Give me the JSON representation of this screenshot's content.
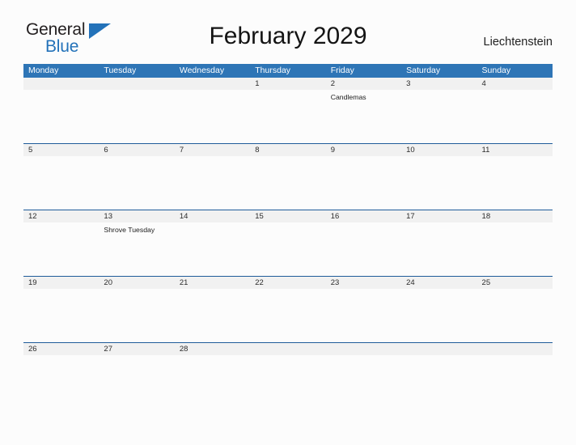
{
  "brand": {
    "name_top": "General",
    "name_bottom": "Blue",
    "triangle_color": "#2372b9"
  },
  "header": {
    "title": "February 2029",
    "country": "Liechtenstein"
  },
  "colors": {
    "header_blue": "#2e75b6",
    "separator_blue": "#1f5c99",
    "date_band_gray": "#f1f1f1",
    "page_background": "#fcfcfc"
  },
  "calendar": {
    "weekdays": [
      "Monday",
      "Tuesday",
      "Wednesday",
      "Thursday",
      "Friday",
      "Saturday",
      "Sunday"
    ],
    "weeks": [
      [
        {
          "date": "",
          "events": []
        },
        {
          "date": "",
          "events": []
        },
        {
          "date": "",
          "events": []
        },
        {
          "date": "1",
          "events": []
        },
        {
          "date": "2",
          "events": [
            "Candlemas"
          ]
        },
        {
          "date": "3",
          "events": []
        },
        {
          "date": "4",
          "events": []
        }
      ],
      [
        {
          "date": "5",
          "events": []
        },
        {
          "date": "6",
          "events": []
        },
        {
          "date": "7",
          "events": []
        },
        {
          "date": "8",
          "events": []
        },
        {
          "date": "9",
          "events": []
        },
        {
          "date": "10",
          "events": []
        },
        {
          "date": "11",
          "events": []
        }
      ],
      [
        {
          "date": "12",
          "events": []
        },
        {
          "date": "13",
          "events": [
            "Shrove Tuesday"
          ]
        },
        {
          "date": "14",
          "events": []
        },
        {
          "date": "15",
          "events": []
        },
        {
          "date": "16",
          "events": []
        },
        {
          "date": "17",
          "events": []
        },
        {
          "date": "18",
          "events": []
        }
      ],
      [
        {
          "date": "19",
          "events": []
        },
        {
          "date": "20",
          "events": []
        },
        {
          "date": "21",
          "events": []
        },
        {
          "date": "22",
          "events": []
        },
        {
          "date": "23",
          "events": []
        },
        {
          "date": "24",
          "events": []
        },
        {
          "date": "25",
          "events": []
        }
      ],
      [
        {
          "date": "26",
          "events": []
        },
        {
          "date": "27",
          "events": []
        },
        {
          "date": "28",
          "events": []
        },
        {
          "date": "",
          "events": []
        },
        {
          "date": "",
          "events": []
        },
        {
          "date": "",
          "events": []
        },
        {
          "date": "",
          "events": []
        }
      ]
    ]
  }
}
